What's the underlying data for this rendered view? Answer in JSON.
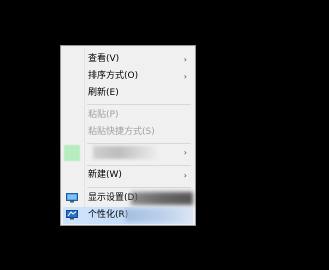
{
  "context_menu": {
    "items": {
      "view": "查看(V)",
      "sort_by": "排序方式(O)",
      "refresh": "刷新(E)",
      "paste": "粘贴(P)",
      "paste_shortcut": "粘贴快捷方式(S)",
      "new": "新建(W)",
      "display_settings": "显示设置(D)",
      "personalize": "个性化(R)"
    },
    "submenu_arrow": "›"
  },
  "colors": {
    "menu_background": "#f0f0f0",
    "highlight": "#c4dcf8",
    "disabled_text": "#a0a0a0",
    "blurred_entry_accent": "#b6ecc0"
  },
  "icons": {
    "display_settings": "monitor-icon",
    "personalize": "personalize-monitor-icon"
  }
}
